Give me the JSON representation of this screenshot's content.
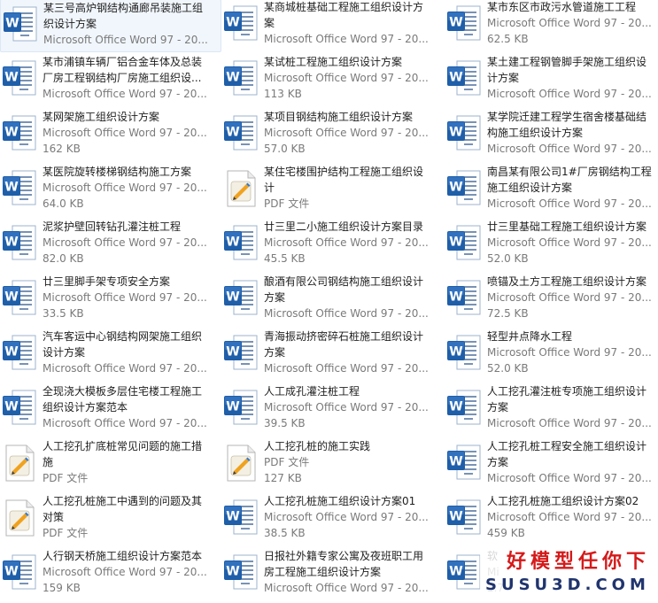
{
  "files": [
    {
      "name": [
        "某三号高炉钢结构通廊吊装施工组",
        "织设计方案"
      ],
      "type": "word",
      "meta": [
        "Microsoft Office Word 97 - 20..."
      ],
      "selected": true
    },
    {
      "name": [
        "某商城桩基础工程施工组织设计方",
        "案"
      ],
      "type": "word",
      "meta": [
        "Microsoft Office Word 97 - 20..."
      ]
    },
    {
      "name": [
        "某市东区市政污水管道施工工程"
      ],
      "type": "word",
      "meta": [
        "Microsoft Office Word 97 - 20...",
        "62.5 KB"
      ]
    },
    {
      "name": [
        "某市浦镇车辆厂铝合金车体及总装",
        "厂房工程钢结构厂房施工组织设..."
      ],
      "type": "word",
      "meta": [
        "Microsoft Office Word 97 - 20..."
      ]
    },
    {
      "name": [
        "某试桩工程施工组织设计方案"
      ],
      "type": "word",
      "meta": [
        "Microsoft Office Word 97 - 20...",
        "113 KB"
      ]
    },
    {
      "name": [
        "某土建工程钢管脚手架施工组织设",
        "计方案"
      ],
      "type": "word",
      "meta": [
        "Microsoft Office Word 97 - 20..."
      ]
    },
    {
      "name": [
        "某网架施工组织设计方案"
      ],
      "type": "word",
      "meta": [
        "Microsoft Office Word 97 - 20...",
        "162 KB"
      ]
    },
    {
      "name": [
        "某项目钢结构施工组织设计方案"
      ],
      "type": "word",
      "meta": [
        "Microsoft Office Word 97 - 20...",
        "57.0 KB"
      ]
    },
    {
      "name": [
        "某学院迁建工程学生宿舍楼基础结",
        "构施工组织设计方案"
      ],
      "type": "word",
      "meta": [
        "Microsoft Office Word 97 - 20..."
      ]
    },
    {
      "name": [
        "某医院旋转楼梯钢结构施工方案"
      ],
      "type": "word",
      "meta": [
        "Microsoft Office Word 97 - 20...",
        "64.0 KB"
      ]
    },
    {
      "name": [
        "某住宅楼围护结构工程施工组织设",
        "计"
      ],
      "type": "pdf",
      "meta": [
        "PDF 文件"
      ]
    },
    {
      "name": [
        "南昌某有限公司1#厂房钢结构工程",
        "施工组织设计方案"
      ],
      "type": "word",
      "meta": [
        "Microsoft Office Word 97 - 20..."
      ]
    },
    {
      "name": [
        "泥浆护壁回转钻孔灌注桩工程"
      ],
      "type": "word",
      "meta": [
        "Microsoft Office Word 97 - 20...",
        "82.0 KB"
      ]
    },
    {
      "name": [
        "廿三里二小施工组织设计方案目录"
      ],
      "type": "word",
      "meta": [
        "Microsoft Office Word 97 - 20...",
        "45.5 KB"
      ]
    },
    {
      "name": [
        "廿三里基础工程施工组织设计方案"
      ],
      "type": "word",
      "meta": [
        "Microsoft Office Word 97 - 20...",
        "52.0 KB"
      ]
    },
    {
      "name": [
        "廿三里脚手架专项安全方案"
      ],
      "type": "word",
      "meta": [
        "Microsoft Office Word 97 - 20...",
        "33.5 KB"
      ]
    },
    {
      "name": [
        "酿酒有限公司钢结构施工组织设计",
        "方案"
      ],
      "type": "word",
      "meta": [
        "Microsoft Office Word 97 - 20..."
      ]
    },
    {
      "name": [
        "喷锚及土方工程施工组织设计方案"
      ],
      "type": "word",
      "meta": [
        "Microsoft Office Word 97 - 20...",
        "72.5 KB"
      ]
    },
    {
      "name": [
        "汽车客运中心钢结构网架施工组织",
        "设计方案"
      ],
      "type": "word",
      "meta": [
        "Microsoft Office Word 97 - 20..."
      ]
    },
    {
      "name": [
        "青海振动挤密碎石桩施工组织设计",
        "方案"
      ],
      "type": "word",
      "meta": [
        "Microsoft Office Word 97 - 20..."
      ]
    },
    {
      "name": [
        "轻型井点降水工程"
      ],
      "type": "word",
      "meta": [
        "Microsoft Office Word 97 - 20...",
        "52.0 KB"
      ]
    },
    {
      "name": [
        "全现浇大模板多层住宅楼工程施工",
        "组织设计方案范本"
      ],
      "type": "word",
      "meta": [
        "Microsoft Office Word 97 - 20..."
      ]
    },
    {
      "name": [
        "人工成孔灌注桩工程"
      ],
      "type": "word",
      "meta": [
        "Microsoft Office Word 97 - 20...",
        "39.5 KB"
      ]
    },
    {
      "name": [
        "人工挖孔灌注桩专项施工组织设计",
        "方案"
      ],
      "type": "word",
      "meta": [
        "Microsoft Office Word 97 - 20..."
      ]
    },
    {
      "name": [
        "人工挖孔扩底桩常见问题的施工措",
        "施"
      ],
      "type": "pdf",
      "meta": [
        "PDF 文件"
      ]
    },
    {
      "name": [
        "人工挖孔桩的施工实践"
      ],
      "type": "pdf",
      "meta": [
        "PDF 文件",
        "127 KB"
      ]
    },
    {
      "name": [
        "人工挖孔桩工程安全施工组织设计",
        "方案"
      ],
      "type": "word",
      "meta": [
        "Microsoft Office Word 97 - 20..."
      ]
    },
    {
      "name": [
        "人工挖孔桩施工中遇到的问题及其",
        "对策"
      ],
      "type": "pdf",
      "meta": [
        "PDF 文件"
      ]
    },
    {
      "name": [
        "人工挖孔桩施工组织设计方案01"
      ],
      "type": "word",
      "meta": [
        "Microsoft Office Word 97 - 20...",
        "38.5 KB"
      ]
    },
    {
      "name": [
        "人工挖孔桩施工组织设计方案02"
      ],
      "type": "word",
      "meta": [
        "Microsoft Office Word 97 - 20...",
        "459 KB"
      ]
    },
    {
      "name": [
        "人行钢天桥施工组织设计方案范本"
      ],
      "type": "word",
      "meta": [
        "Microsoft Office Word 97 - 20...",
        "159 KB"
      ]
    },
    {
      "name": [
        "日报社外籍专家公寓及夜班职工用",
        "房工程施工组织设计方案"
      ],
      "type": "word",
      "meta": [
        "Microsoft Office Word 97 - 20..."
      ]
    },
    {
      "name": [
        "软"
      ],
      "type": "word",
      "meta": [
        "Mi",
        "2.7"
      ]
    }
  ],
  "watermark": {
    "cn": "好模型任你下",
    "en": "SUSU3D.COM"
  }
}
